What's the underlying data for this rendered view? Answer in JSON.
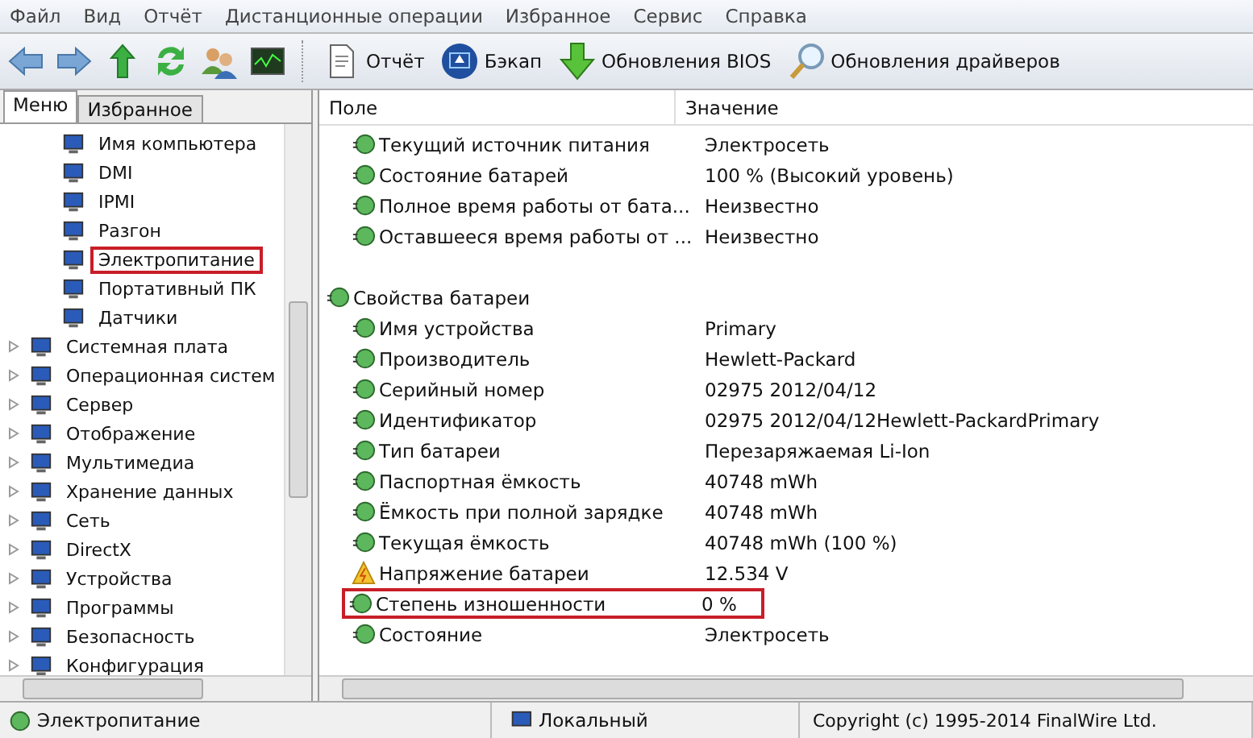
{
  "menu": [
    "Файл",
    "Вид",
    "Отчёт",
    "Дистанционные операции",
    "Избранное",
    "Сервис",
    "Справка"
  ],
  "toolbar": {
    "buttons": [
      {
        "label": "Отчёт",
        "kind": "report"
      },
      {
        "label": "Бэкап",
        "kind": "backup"
      },
      {
        "label": "Обновления BIOS",
        "kind": "download"
      },
      {
        "label": "Обновления драйверов",
        "kind": "search"
      }
    ]
  },
  "tabs": [
    {
      "label": "Меню",
      "selected": true
    },
    {
      "label": "Избранное",
      "selected": false
    }
  ],
  "tree": {
    "visible_children": [
      {
        "label": "Имя компьютера",
        "highlighted": false
      },
      {
        "label": "DMI",
        "highlighted": false
      },
      {
        "label": "IPMI",
        "highlighted": false
      },
      {
        "label": "Разгон",
        "highlighted": false
      },
      {
        "label": "Электропитание",
        "highlighted": true
      },
      {
        "label": "Портативный ПК",
        "highlighted": false
      },
      {
        "label": "Датчики",
        "highlighted": false
      }
    ],
    "items": [
      {
        "label": "Системная плата",
        "expanded": false
      },
      {
        "label": "Операционная систем",
        "expanded": false
      },
      {
        "label": "Сервер",
        "expanded": false
      },
      {
        "label": "Отображение",
        "expanded": false
      },
      {
        "label": "Мультимедиа",
        "expanded": false
      },
      {
        "label": "Хранение данных",
        "expanded": false
      },
      {
        "label": "Сеть",
        "expanded": false
      },
      {
        "label": "DirectX",
        "expanded": false
      },
      {
        "label": "Устройства",
        "expanded": false
      },
      {
        "label": "Программы",
        "expanded": false
      },
      {
        "label": "Безопасность",
        "expanded": false
      },
      {
        "label": "Конфигурация",
        "expanded": false
      }
    ]
  },
  "table": {
    "columns": [
      "Поле",
      "Значение"
    ],
    "groups": [
      {
        "rows": [
          {
            "field": "Текущий источник питания",
            "value": "Электросеть",
            "kind": "power",
            "highlighted": false
          },
          {
            "field": "Состояние батарей",
            "value": "100 % (Высокий уровень)",
            "kind": "power",
            "highlighted": false
          },
          {
            "field": "Полное время работы от бата...",
            "value": "Неизвестно",
            "kind": "power",
            "highlighted": false
          },
          {
            "field": "Оставшееся время работы от ...",
            "value": "Неизвестно",
            "kind": "power",
            "highlighted": false
          }
        ]
      },
      {
        "title": "Свойства батареи",
        "rows": [
          {
            "field": "Имя устройства",
            "value": "Primary",
            "kind": "power",
            "highlighted": false
          },
          {
            "field": "Производитель",
            "value": "Hewlett-Packard",
            "kind": "power",
            "highlighted": false
          },
          {
            "field": "Серийный номер",
            "value": "02975 2012/04/12",
            "kind": "power",
            "highlighted": false
          },
          {
            "field": "Идентификатор",
            "value": "02975 2012/04/12Hewlett-PackardPrimary",
            "kind": "power",
            "highlighted": false
          },
          {
            "field": "Тип батареи",
            "value": "Перезаряжаемая Li-Ion",
            "kind": "power",
            "highlighted": false
          },
          {
            "field": "Паспортная ёмкость",
            "value": "40748 mWh",
            "kind": "power",
            "highlighted": false
          },
          {
            "field": "Ёмкость при полной зарядке",
            "value": "40748 mWh",
            "kind": "power",
            "highlighted": false
          },
          {
            "field": "Текущая ёмкость",
            "value": "40748 mWh  (100 %)",
            "kind": "power",
            "highlighted": false
          },
          {
            "field": "Напряжение батареи",
            "value": "12.534 V",
            "kind": "warning",
            "highlighted": false
          },
          {
            "field": "Степень изношенности",
            "value": "0 %",
            "kind": "power",
            "highlighted": true
          },
          {
            "field": "Состояние",
            "value": "Электросеть",
            "kind": "power",
            "highlighted": false
          }
        ]
      }
    ]
  },
  "status_bar": {
    "page": "Электропитание",
    "mode": "Локальный",
    "copyright": "Copyright (c) 1995-2014 FinalWire Ltd."
  }
}
